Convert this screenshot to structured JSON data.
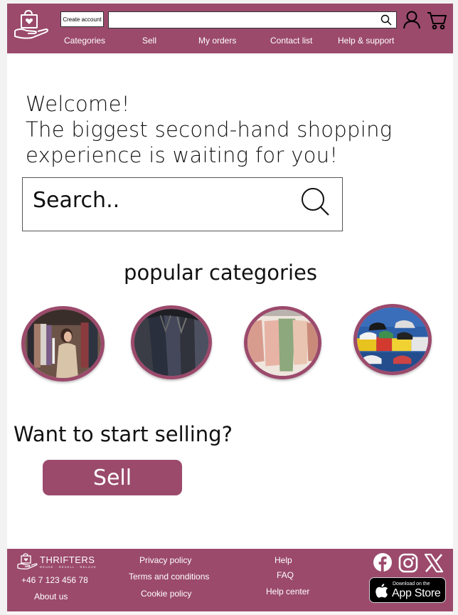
{
  "header": {
    "create_account_label": "Create account",
    "search_value": "",
    "nav": [
      "Categories",
      "Sell",
      "My orders",
      "Contact list",
      "Help & support"
    ],
    "accent_color": "#9b4a6c"
  },
  "main": {
    "welcome_line1": "Welcome!",
    "welcome_line2": "The biggest second-hand shopping",
    "welcome_line3": "experience is waiting for you!",
    "search_placeholder": "Search..",
    "popular_title": "popular categories",
    "categories": [
      {
        "icon": "woman-shopping-clothes-photo"
      },
      {
        "icon": "suit-jackets-photo"
      },
      {
        "icon": "baby-clothes-photo"
      },
      {
        "icon": "sneakers-photo"
      }
    ],
    "sell_title": "Want to start selling?",
    "sell_button_label": "Sell"
  },
  "footer": {
    "brand": "THRIFTERS",
    "tagline": "REUSE · RESELL · RELOVE",
    "phone": "+46 7 123 456 78",
    "about": "About us",
    "privacy": "Privacy policy",
    "terms": "Terms and conditions",
    "cookie": "Cookie policy",
    "help": "Help",
    "faq": "FAQ",
    "help_center": "Help center",
    "social": [
      "facebook-icon",
      "instagram-icon",
      "x-icon"
    ],
    "appstore_small": "Download on the",
    "appstore_big": "App Store"
  }
}
